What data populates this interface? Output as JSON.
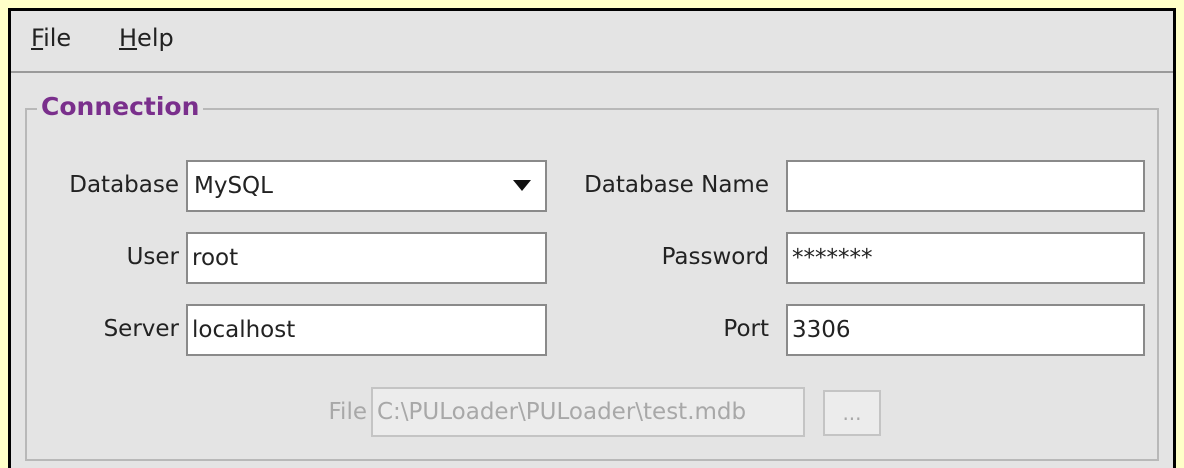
{
  "menu": {
    "file": {
      "mnemonic": "F",
      "rest": "ile"
    },
    "help": {
      "mnemonic": "H",
      "rest": "elp"
    }
  },
  "connection": {
    "title": "Connection",
    "database": {
      "label": "Database",
      "value": "MySQL"
    },
    "database_name": {
      "label": "Database Name",
      "value": ""
    },
    "user": {
      "label": "User",
      "value": "root"
    },
    "password": {
      "label": "Password",
      "value": "*******"
    },
    "server": {
      "label": "Server",
      "value": "localhost"
    },
    "port": {
      "label": "Port",
      "value": "3306"
    },
    "file": {
      "label": "File",
      "value": "C:\\PULoader\\PULoader\\test.mdb",
      "browse_label": "..."
    }
  },
  "colors": {
    "group_title": "#7a2f8c",
    "window_bg": "#e4e4e4",
    "outer_bg": "#ffffc8",
    "disabled_text": "#a8a8a8"
  }
}
